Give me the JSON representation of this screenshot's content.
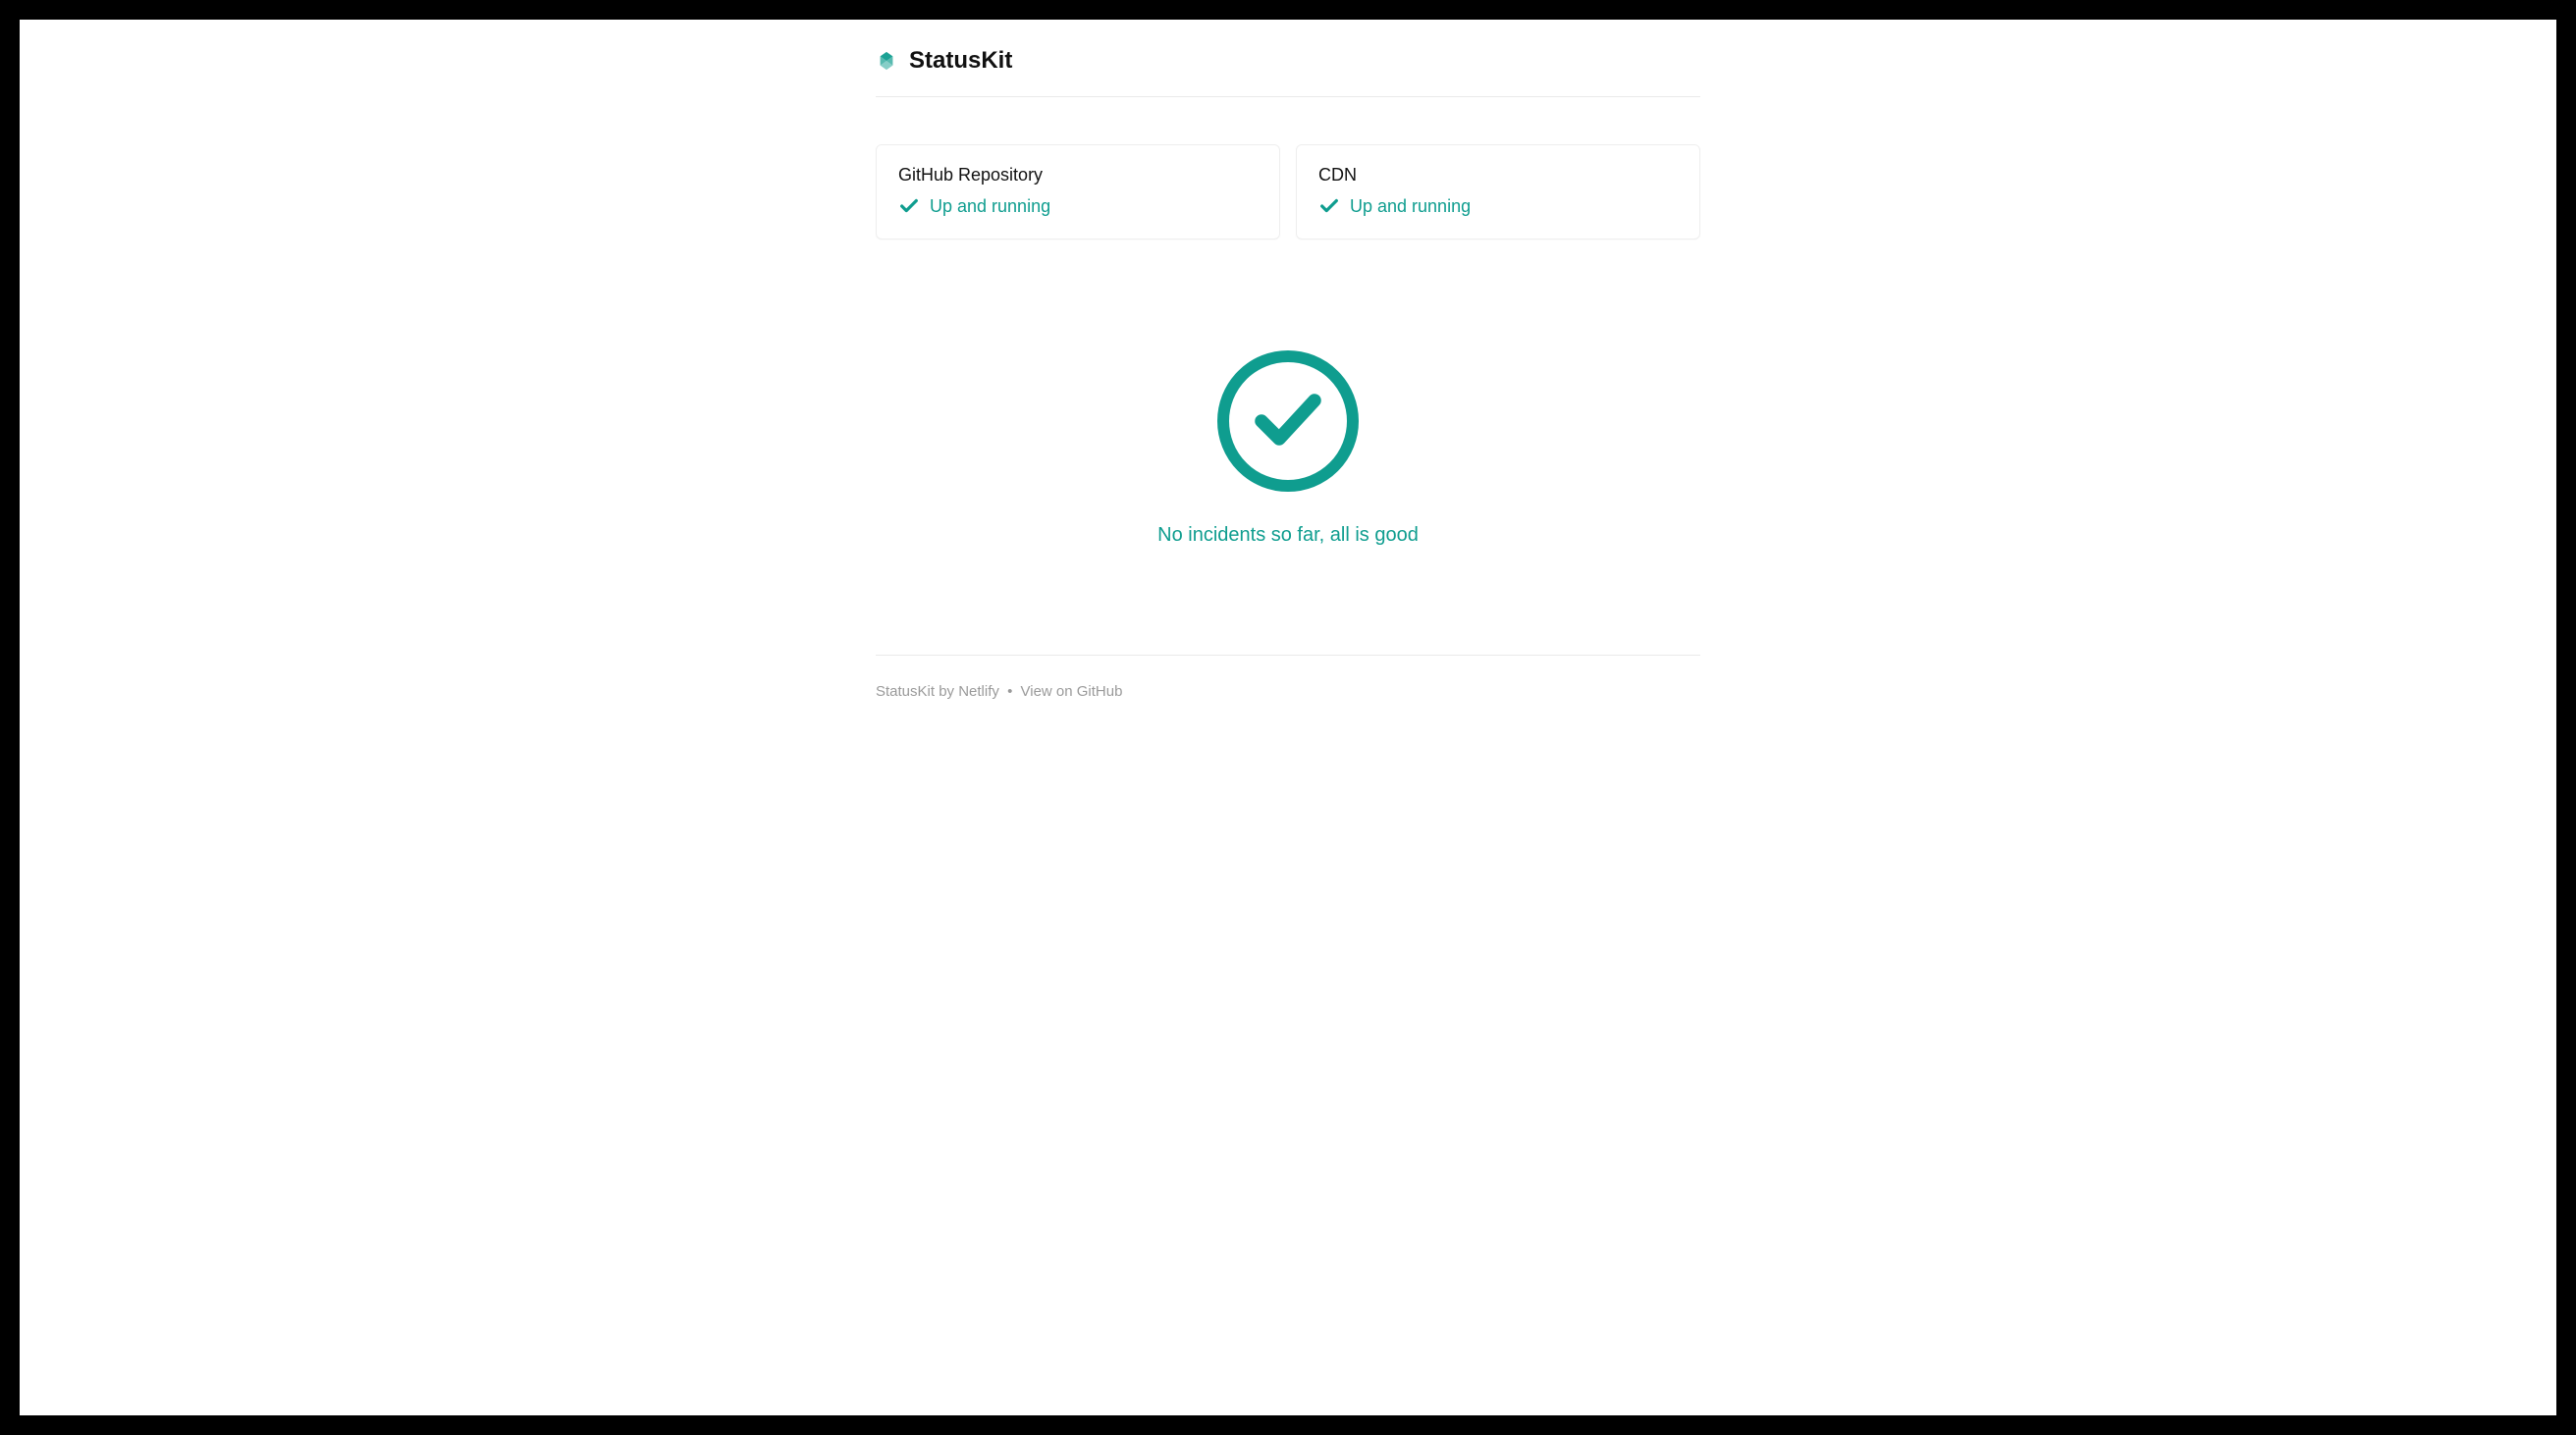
{
  "header": {
    "title": "StatusKit"
  },
  "services": [
    {
      "name": "GitHub Repository",
      "status": "Up and running"
    },
    {
      "name": "CDN",
      "status": "Up and running"
    }
  ],
  "hero": {
    "message": "No incidents so far, all is good"
  },
  "footer": {
    "prefix": "StatusKit by ",
    "brand": "Netlify",
    "separator": " • ",
    "link": "View on GitHub"
  },
  "colors": {
    "accent": "#0f9d8f"
  }
}
